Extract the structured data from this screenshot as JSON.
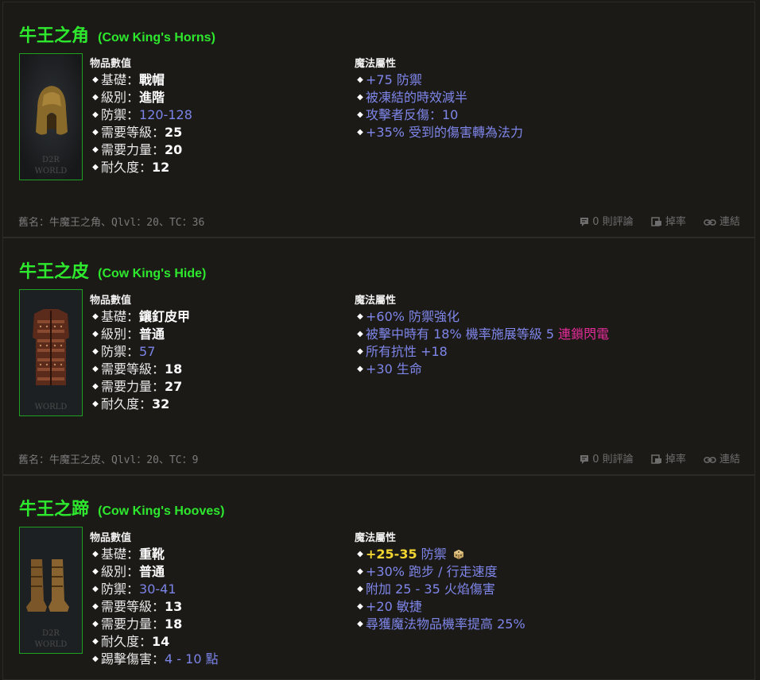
{
  "items": [
    {
      "title": "牛王之角",
      "title_en": "(Cow King's Horns)",
      "stats_header": "物品數值",
      "magic_header": "魔法屬性",
      "stats": [
        {
          "label": "基礎：",
          "value": "戰帽"
        },
        {
          "label": "級別：",
          "value": "進階"
        },
        {
          "label": "防禦：",
          "value": "120-128"
        },
        {
          "label": "需要等級：",
          "value": "25"
        },
        {
          "label": "需要力量：",
          "value": "20"
        },
        {
          "label": "耐久度：",
          "value": "12"
        }
      ],
      "magic": [
        {
          "text": "+75 防禦"
        },
        {
          "text": "被凍結的時效減半"
        },
        {
          "text": "攻擊者反傷：10"
        },
        {
          "text": "+35% 受到的傷害轉為法力"
        }
      ],
      "note": "舊名：牛魔王之角、Qlvl：20、TC：36",
      "comments": "0 則評論",
      "drops": "掉率",
      "link": "連結",
      "icon": "horns-hood-image"
    },
    {
      "title": "牛王之皮",
      "title_en": "(Cow King's Hide)",
      "stats_header": "物品數值",
      "magic_header": "魔法屬性",
      "stats": [
        {
          "label": "基礎：",
          "value": "鑲釘皮甲"
        },
        {
          "label": "級別：",
          "value": "普通"
        },
        {
          "label": "防禦：",
          "value": "57"
        },
        {
          "label": "需要等級：",
          "value": "18"
        },
        {
          "label": "需要力量：",
          "value": "27"
        },
        {
          "label": "耐久度：",
          "value": "32"
        }
      ],
      "magic": [
        {
          "text": "+60% 防禦強化"
        },
        {
          "text": "被擊中時有 18% 機率施展等級 5 ",
          "highlight": "連鎖閃電"
        },
        {
          "text": "所有抗性 +18"
        },
        {
          "text": "+30 生命"
        }
      ],
      "note": "舊名：牛魔王之皮、Qlvl：20、TC：9",
      "comments": "0 則評論",
      "drops": "掉率",
      "link": "連結",
      "icon": "studded-leather-armor-image"
    },
    {
      "title": "牛王之蹄",
      "title_en": "(Cow King's Hooves)",
      "stats_header": "物品數值",
      "magic_header": "魔法屬性",
      "stats": [
        {
          "label": "基礎：",
          "value": "重靴"
        },
        {
          "label": "級別：",
          "value": "普通"
        },
        {
          "label": "防禦：",
          "value": "30-41"
        },
        {
          "label": "需要等級：",
          "value": "13"
        },
        {
          "label": "需要力量：",
          "value": "18"
        },
        {
          "label": "耐久度：",
          "value": "14"
        },
        {
          "label": "踢擊傷害：",
          "value": "4 - 10 點"
        }
      ],
      "magic": [
        {
          "gold": "+25-35",
          "text": " 防禦"
        },
        {
          "text": "+30% 跑步 / 行走速度"
        },
        {
          "text": "附加 25 - 35 火焰傷害"
        },
        {
          "text": "+20 敏捷"
        },
        {
          "text": "尋獲魔法物品機率提高 25%"
        }
      ],
      "icon": "heavy-boots-image"
    }
  ],
  "watermark": "D2R WORLD",
  "colors": {
    "title": "#2ee82e",
    "magic": "#7f86ea",
    "highlight": "#e72c9b",
    "variable": "#f2d530",
    "background": "#1b1a17"
  }
}
